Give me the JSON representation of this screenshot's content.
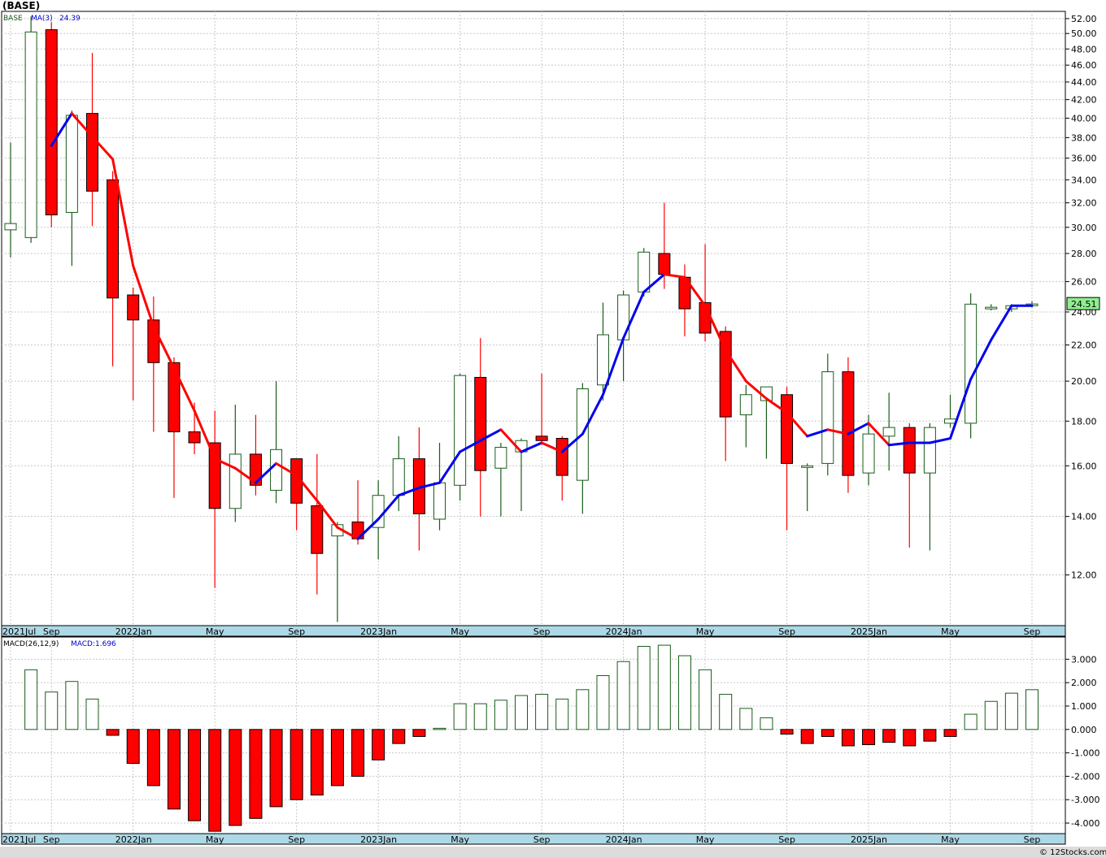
{
  "header": {
    "title": "(BASE)"
  },
  "legend": {
    "symbol": "BASE",
    "ma_label": "MA(3)",
    "ma_value": "24.39",
    "macd_label": "MACD(26,12,9)",
    "macd_value_label": "MACD:1.696"
  },
  "price_tag": "24.51",
  "credit": "© 12Stocks.com",
  "colors": {
    "up_fill": "#ffffff",
    "up_stroke": "#1a5c1a",
    "down_fill": "#ff0000",
    "ma_up": "#0000ee",
    "ma_down": "#ff0000",
    "axis_band": "#add8e6",
    "tag_fill": "#90ee90"
  },
  "chart_data": [
    {
      "type": "candlestick",
      "scale": "log",
      "ylim": [
        10.5,
        53
      ],
      "y_ticks": [
        "12.00",
        "14.00",
        "16.00",
        "18.00",
        "20.00",
        "22.00",
        "24.00",
        "26.00",
        "28.00",
        "30.00",
        "32.00",
        "34.00",
        "36.00",
        "38.00",
        "40.00",
        "42.00",
        "44.00",
        "46.00",
        "48.00",
        "50.00",
        "52.00"
      ],
      "x_labels": [
        "2021Jul",
        "Sep",
        "2022Jan",
        "May",
        "Sep",
        "2023Jan",
        "May",
        "Sep",
        "2024Jan",
        "May",
        "Sep",
        "2025Jan",
        "May",
        "Sep"
      ],
      "ohlc": [
        [
          29.8,
          37.5,
          27.7,
          30.3
        ],
        [
          29.2,
          52.3,
          28.8,
          50.2
        ],
        [
          50.5,
          51.5,
          30.0,
          31.0
        ],
        [
          31.2,
          40.8,
          27.1,
          40.3
        ],
        [
          40.5,
          47.5,
          30.1,
          33.0
        ],
        [
          34.0,
          34.8,
          20.8,
          24.9
        ],
        [
          25.1,
          25.6,
          19.0,
          23.5
        ],
        [
          23.5,
          25.0,
          17.5,
          21.0
        ],
        [
          21.0,
          21.3,
          14.7,
          17.5
        ],
        [
          17.5,
          18.9,
          16.5,
          17.0
        ],
        [
          17.0,
          18.5,
          11.6,
          14.3
        ],
        [
          14.3,
          18.8,
          13.8,
          16.5
        ],
        [
          16.5,
          18.3,
          14.8,
          15.2
        ],
        [
          15.0,
          20.0,
          14.5,
          16.7
        ],
        [
          16.3,
          16.3,
          13.5,
          14.5
        ],
        [
          14.4,
          16.5,
          11.4,
          12.7
        ],
        [
          13.3,
          13.8,
          10.6,
          13.7
        ],
        [
          13.8,
          15.4,
          13.0,
          13.2
        ],
        [
          13.6,
          15.4,
          12.5,
          14.8
        ],
        [
          14.8,
          17.3,
          14.2,
          16.3
        ],
        [
          16.3,
          17.7,
          12.8,
          14.1
        ],
        [
          13.9,
          17.0,
          13.5,
          15.3
        ],
        [
          15.2,
          20.4,
          14.6,
          20.3
        ],
        [
          20.2,
          22.4,
          14.0,
          15.8
        ],
        [
          15.9,
          17.0,
          14.0,
          16.8
        ],
        [
          16.6,
          17.2,
          14.2,
          17.1
        ],
        [
          17.3,
          20.4,
          16.9,
          17.1
        ],
        [
          17.2,
          17.3,
          14.6,
          15.6
        ],
        [
          15.4,
          19.9,
          14.1,
          19.6
        ],
        [
          19.8,
          24.6,
          19.0,
          22.6
        ],
        [
          22.3,
          25.4,
          20.0,
          25.1
        ],
        [
          25.3,
          28.4,
          25.0,
          28.1
        ],
        [
          28.0,
          32.0,
          25.5,
          26.5
        ],
        [
          26.3,
          27.2,
          22.5,
          24.2
        ],
        [
          24.6,
          28.7,
          22.2,
          22.7
        ],
        [
          22.8,
          23.1,
          16.2,
          18.2
        ],
        [
          18.3,
          19.8,
          16.8,
          19.3
        ],
        [
          19.0,
          19.7,
          16.3,
          19.7
        ],
        [
          19.3,
          19.7,
          13.5,
          16.1
        ],
        [
          16.0,
          16.1,
          14.2,
          16.0
        ],
        [
          16.1,
          21.5,
          15.6,
          20.5
        ],
        [
          20.5,
          21.3,
          14.9,
          15.6
        ],
        [
          15.7,
          18.3,
          15.2,
          17.4
        ],
        [
          17.3,
          19.4,
          15.8,
          17.7
        ],
        [
          17.7,
          17.9,
          12.9,
          15.7
        ],
        [
          15.7,
          17.9,
          12.8,
          17.7
        ],
        [
          17.9,
          19.3,
          17.7,
          18.1
        ],
        [
          17.9,
          25.2,
          17.2,
          24.5
        ],
        [
          24.3,
          24.5,
          24.1,
          24.3
        ],
        [
          24.2,
          24.5,
          24.0,
          24.4
        ],
        [
          24.4,
          24.7,
          24.3,
          24.51
        ]
      ],
      "ma3": [
        null,
        null,
        37.2,
        40.5,
        38.1,
        35.9,
        27.1,
        23.1,
        20.7,
        18.5,
        16.3,
        15.9,
        15.3,
        16.1,
        15.6,
        14.6,
        13.6,
        13.2,
        13.9,
        14.8,
        15.1,
        15.3,
        16.6,
        17.1,
        17.6,
        16.6,
        17.0,
        16.6,
        17.4,
        19.3,
        22.4,
        25.3,
        26.5,
        26.3,
        24.4,
        21.7,
        20.0,
        19.1,
        18.4,
        17.3,
        17.6,
        17.4,
        17.9,
        16.9,
        17.0,
        17.0,
        17.2,
        20.1,
        22.3,
        24.4,
        24.4
      ],
      "macd_hist": [
        2.55,
        1.6,
        2.05,
        1.3,
        -0.25,
        -1.45,
        -2.4,
        -3.4,
        -3.9,
        -4.35,
        -4.1,
        -3.8,
        -3.3,
        -3.0,
        -2.8,
        -2.4,
        -2.0,
        -1.3,
        -0.6,
        -0.3,
        0.05,
        1.1,
        1.1,
        1.25,
        1.45,
        1.5,
        1.3,
        1.7,
        2.3,
        2.9,
        3.55,
        3.6,
        3.15,
        2.55,
        1.5,
        0.9,
        0.5,
        -0.2,
        -0.6,
        -0.3,
        -0.7,
        -0.65,
        -0.55,
        -0.7,
        -0.5,
        -0.3,
        0.65,
        1.2,
        1.55,
        1.7
      ],
      "macd_ylim": [
        -4.45,
        3.95
      ],
      "macd_ticks": [
        "-4.000",
        "-3.000",
        "-2.000",
        "-1.000",
        "0.000",
        "1.000",
        "2.000",
        "3.000"
      ]
    }
  ]
}
